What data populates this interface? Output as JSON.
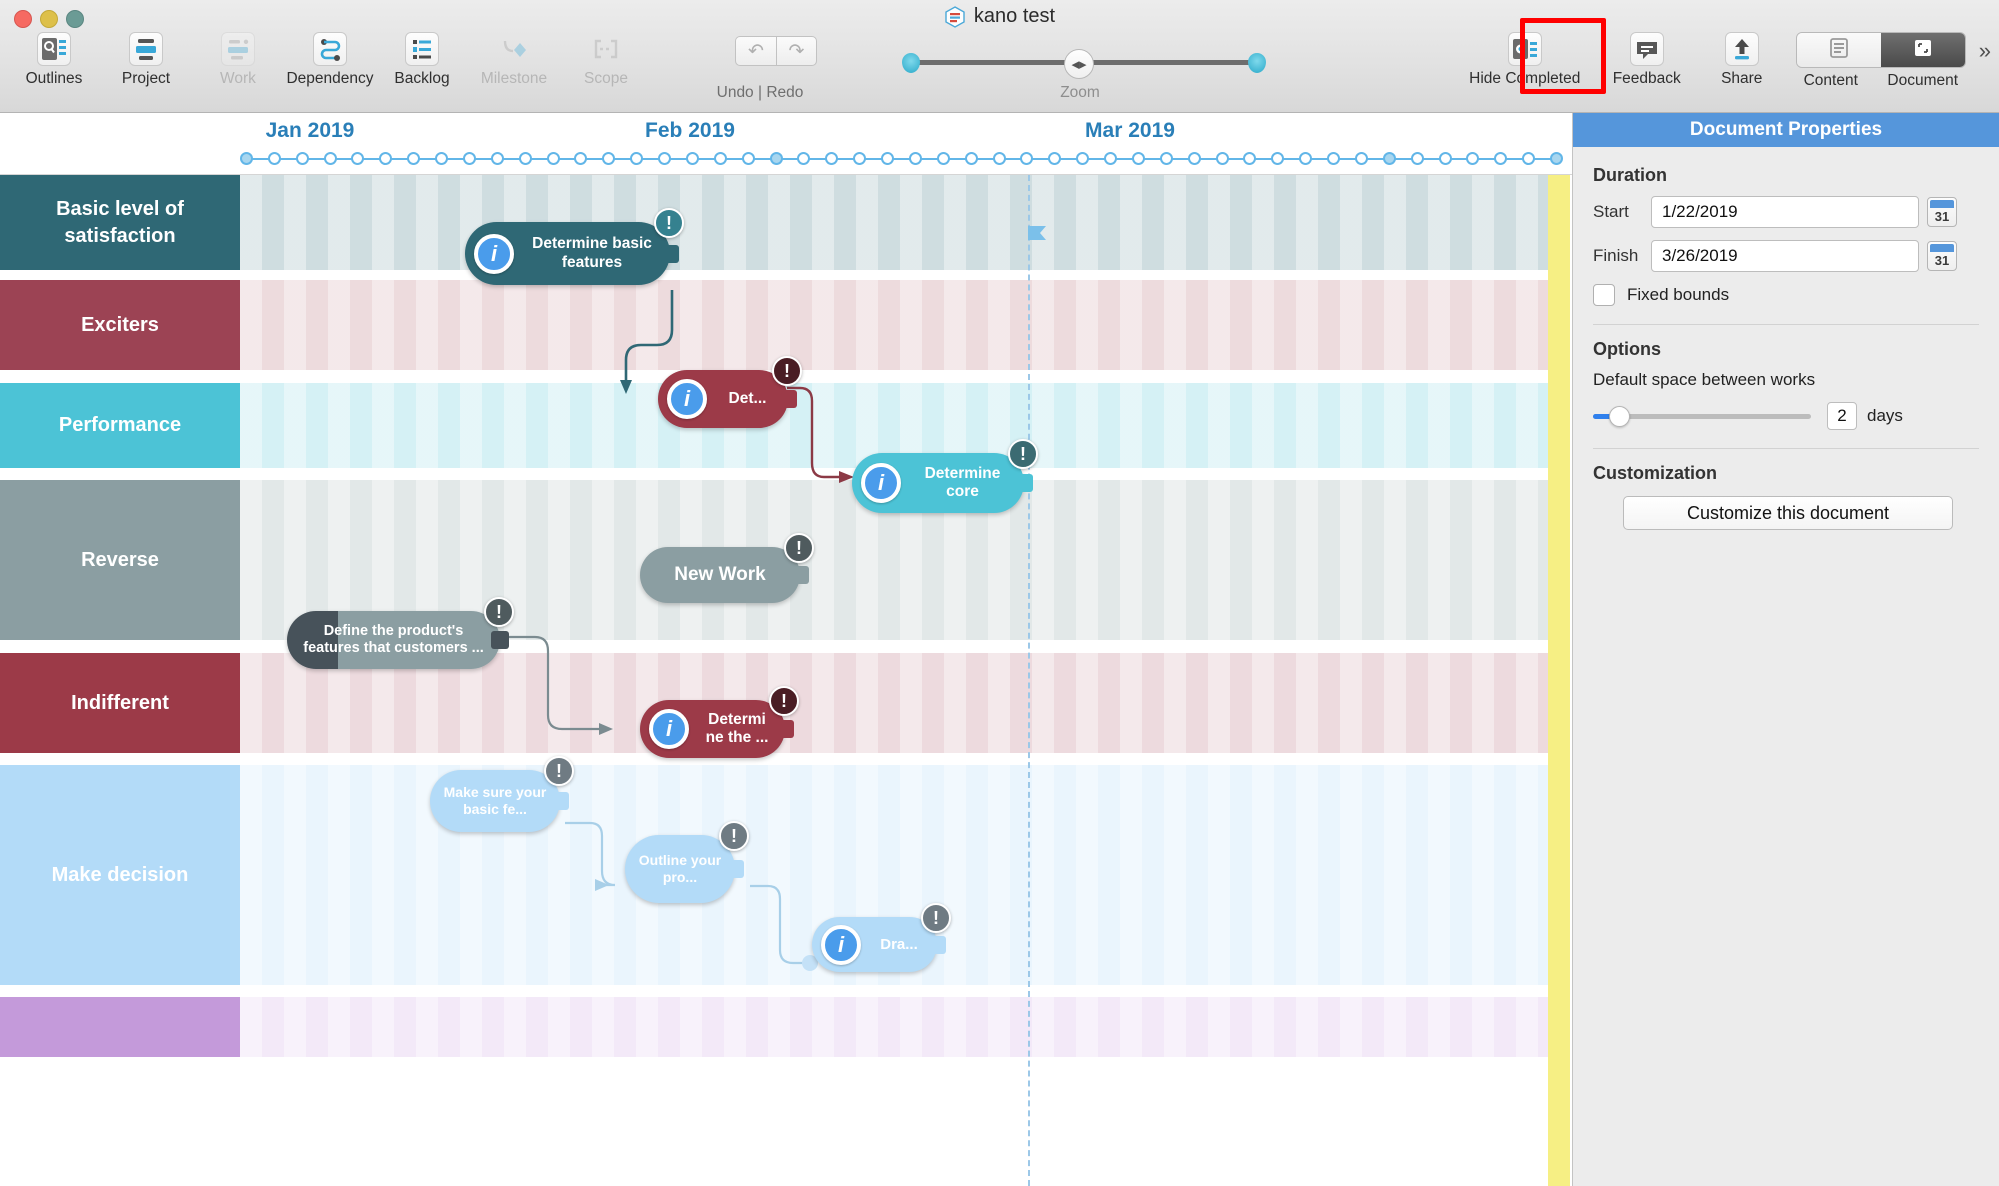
{
  "window": {
    "title": "kano test",
    "traffic_lights": [
      "close",
      "minimize",
      "maximize"
    ]
  },
  "toolbar": {
    "left_items": [
      {
        "label": "Outlines",
        "icon": "outlines-icon",
        "enabled": true
      },
      {
        "label": "Project",
        "icon": "project-icon",
        "enabled": true
      },
      {
        "label": "Work",
        "icon": "work-icon",
        "enabled": false
      },
      {
        "label": "Dependency",
        "icon": "dependency-icon",
        "enabled": true
      },
      {
        "label": "Backlog",
        "icon": "backlog-icon",
        "enabled": true
      },
      {
        "label": "Milestone",
        "icon": "milestone-icon",
        "enabled": false
      },
      {
        "label": "Scope",
        "icon": "scope-icon",
        "enabled": false
      }
    ],
    "undo_redo_label": "Undo | Redo",
    "undo_icon": "undo-arrow-icon",
    "redo_icon": "redo-arrow-icon",
    "zoom_label": "Zoom",
    "zoom_icon": "zoom-resize-icon",
    "right_items": [
      {
        "label": "Hide Completed",
        "icon": "hide-completed-icon"
      },
      {
        "label": "Feedback",
        "icon": "feedback-icon"
      },
      {
        "label": "Share",
        "icon": "share-upload-icon"
      }
    ],
    "segmented": [
      {
        "label": "Content",
        "icon": "content-list-icon",
        "active": false
      },
      {
        "label": "Document",
        "icon": "document-frame-icon",
        "active": true
      }
    ],
    "overflow_label": "»",
    "annotation": {
      "target": "Share",
      "color": "#ff0000"
    }
  },
  "timeline": {
    "months": [
      {
        "label": "Jan 2019"
      },
      {
        "label": "Feb 2019"
      },
      {
        "label": "Mar 2019"
      }
    ],
    "today_marker": true,
    "lanes": [
      {
        "name": "Basic level of satisfaction",
        "color": "#2f6875",
        "band": "#cfdde0"
      },
      {
        "name": "Exciters",
        "color": "#9c4354",
        "band": "#eddbdd"
      },
      {
        "name": "Performance",
        "color": "#4cc3d6",
        "band": "#d5f1f5"
      },
      {
        "name": "Reverse",
        "color": "#8b9ea2",
        "band": "#e2e8e8"
      },
      {
        "name": "Indifferent",
        "color": "#9c3a48",
        "band": "#eddade"
      },
      {
        "name": "Make decision",
        "color": "#b3dbf8",
        "band": "#eaf5fd"
      },
      {
        "name": "",
        "color": "#c49ada",
        "band": "#f3e9f8"
      }
    ],
    "works": [
      {
        "id": "w1",
        "title": "Determine basic features",
        "lane": "Basic level of satisfaction",
        "color": "#2f6875",
        "badge": "i",
        "alert": "!",
        "alert_color": "#35818f"
      },
      {
        "id": "w2",
        "title": "Det...",
        "lane": "Exciters",
        "color": "#9c3a48",
        "badge": "i",
        "alert": "!",
        "alert_color": "#4a1d24"
      },
      {
        "id": "w3",
        "title": "Determine core",
        "lane": "Performance",
        "color": "#4cc3d6",
        "badge": "i",
        "alert": "!",
        "alert_color": "#3b6b72"
      },
      {
        "id": "w4",
        "title": "New Work",
        "lane": "Reverse",
        "color": "#8b9ea2",
        "badge": "",
        "alert": "!",
        "alert_color": "#4f5b5e"
      },
      {
        "id": "w5",
        "title": "Define the product's features that customers ...",
        "lane": "Reverse",
        "color": "#47525a",
        "badge": "",
        "alert": "!",
        "alert_color": "#4f5b5e"
      },
      {
        "id": "w6",
        "title": "Determi ne the ...",
        "lane": "Indifferent",
        "color": "#9c3a48",
        "badge": "i",
        "alert": "!",
        "alert_color": "#4a1d24"
      },
      {
        "id": "w7",
        "title": "Make sure your basic fe...",
        "lane": "Make decision",
        "color": "#b3dbf8",
        "badge": "",
        "alert": "!",
        "alert_color": "#6f7b83"
      },
      {
        "id": "w8",
        "title": "Outline your pro...",
        "lane": "Make decision",
        "color": "#b3dbf8",
        "badge": "",
        "alert": "!",
        "alert_color": "#6f7b83"
      },
      {
        "id": "w9",
        "title": "Dra...",
        "lane": "Make decision",
        "color": "#b3dbf8",
        "badge": "i",
        "alert": "!",
        "alert_color": "#6f7b83"
      }
    ]
  },
  "inspector": {
    "title": "Document Properties",
    "duration": {
      "heading": "Duration",
      "start_label": "Start",
      "start_value": "1/22/2019",
      "finish_label": "Finish",
      "finish_value": "3/26/2019",
      "calendar_icon": "calendar-31-icon",
      "fixed_bounds_label": "Fixed bounds",
      "fixed_bounds_checked": false
    },
    "options": {
      "heading": "Options",
      "space_label": "Default space between works",
      "space_value": "2",
      "space_unit": "days"
    },
    "customization": {
      "heading": "Customization",
      "button_label": "Customize this document"
    }
  }
}
